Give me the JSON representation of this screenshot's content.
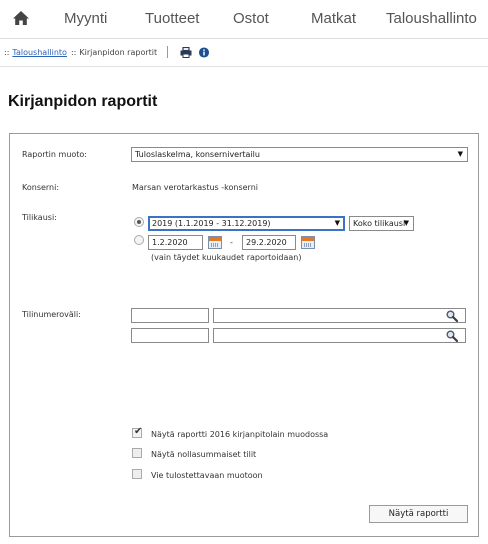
{
  "nav": {
    "items": [
      "Myynti",
      "Tuotteet",
      "Ostot",
      "Matkat",
      "Taloushallinto"
    ]
  },
  "breadcrumb": {
    "sep": "::",
    "link": "Taloushallinto",
    "current": "Kirjanpidon raportit"
  },
  "page": {
    "title": "Kirjanpidon raportit"
  },
  "form": {
    "report_format_label": "Raportin muoto:",
    "report_format_value": "Tuloslaskelma, konsernivertailu",
    "group_label": "Konserni:",
    "group_value": "Marsan verotarkastus -konserni",
    "fiscal_label": "Tilikausi:",
    "fiscal_value": "2019 (1.1.2019 - 31.12.2019)",
    "period_value": "Koko tilikausi",
    "date_from": "1.2.2020",
    "date_dash": "-",
    "date_to": "29.2.2020",
    "date_note": "(vain täydet kuukaudet raportoidaan)",
    "account_range_label": "Tilinumeroväli:",
    "checkbox_2016": "Näytä raportti 2016 kirjanpitolain muodossa",
    "checkbox_zero": "Näytä nollasummaiset tilit",
    "checkbox_print": "Vie tulostettavaan muotoon",
    "show_button": "Näytä raportti"
  },
  "colors": {
    "link": "#2a63b8",
    "calendar_accent": "#e07a2a",
    "focus_border": "#3b73c4"
  },
  "icons": {
    "home": "home-icon",
    "print": "printer-icon",
    "info": "info-icon",
    "calendar": "calendar-icon",
    "search": "search-icon"
  }
}
